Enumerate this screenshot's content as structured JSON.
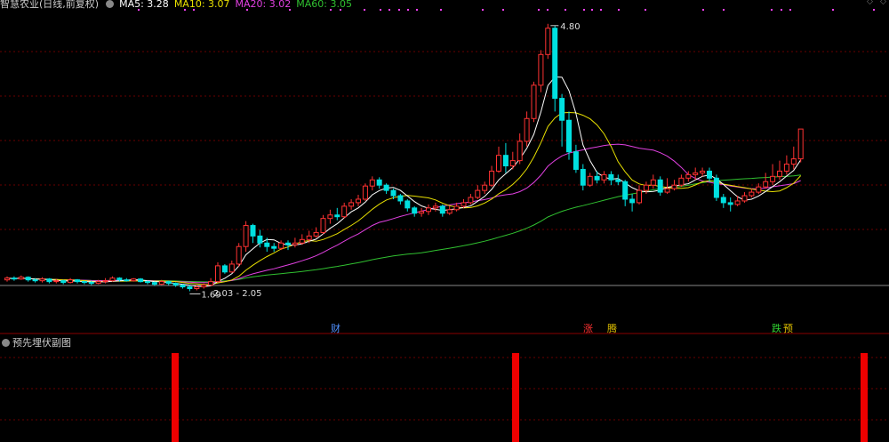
{
  "header": {
    "title": "智慧农业(日线,前复权)",
    "ma5_label": "MA5: 3.28",
    "ma10_label": "MA10: 3.07",
    "ma20_label": "MA20: 3.02",
    "ma60_label": "MA60: 3.05"
  },
  "subchart": {
    "title": "预先埋伏副图"
  },
  "colors": {
    "up": "#ff3232",
    "down": "#00e0e0",
    "ma5": "#ffffff",
    "ma10": "#e8e000",
    "ma20": "#e040e0",
    "ma60": "#30c030",
    "dot": "#ff40ff",
    "signal": "#ee0000",
    "grid": "#6a0000",
    "sep": "#8a0000",
    "title": "#cccccc"
  },
  "chart_data": {
    "type": "candlestick",
    "ylim": [
      1.4,
      4.95
    ],
    "annotations": {
      "high": "4.80",
      "low": "1.69",
      "range": "2.03 - 2.05"
    },
    "event_labels": [
      {
        "text": "财",
        "color": "#5090ff"
      },
      {
        "text": "涨",
        "color": "#ff3232"
      },
      {
        "text": "腾",
        "color": "#e0c000"
      },
      {
        "text": "跌",
        "color": "#30d030"
      },
      {
        "text": "预",
        "color": "#e0c000"
      }
    ],
    "candles": [
      [
        1.88,
        1.9,
        1.86,
        1.92
      ],
      [
        1.9,
        1.89,
        1.87,
        1.92
      ],
      [
        1.89,
        1.91,
        1.88,
        1.93
      ],
      [
        1.91,
        1.88,
        1.86,
        1.92
      ],
      [
        1.88,
        1.87,
        1.85,
        1.9
      ],
      [
        1.87,
        1.89,
        1.85,
        1.91
      ],
      [
        1.89,
        1.86,
        1.84,
        1.9
      ],
      [
        1.86,
        1.87,
        1.84,
        1.89
      ],
      [
        1.87,
        1.85,
        1.83,
        1.88
      ],
      [
        1.85,
        1.88,
        1.84,
        1.9
      ],
      [
        1.88,
        1.86,
        1.84,
        1.89
      ],
      [
        1.86,
        1.85,
        1.83,
        1.87
      ],
      [
        1.85,
        1.84,
        1.82,
        1.87
      ],
      [
        1.84,
        1.86,
        1.83,
        1.88
      ],
      [
        1.86,
        1.87,
        1.84,
        1.9
      ],
      [
        1.87,
        1.9,
        1.86,
        1.92
      ],
      [
        1.9,
        1.88,
        1.86,
        1.91
      ],
      [
        1.88,
        1.87,
        1.86,
        1.9
      ],
      [
        1.87,
        1.89,
        1.86,
        1.9
      ],
      [
        1.89,
        1.86,
        1.85,
        1.9
      ],
      [
        1.86,
        1.85,
        1.83,
        1.87
      ],
      [
        1.85,
        1.83,
        1.81,
        1.86
      ],
      [
        1.83,
        1.86,
        1.82,
        1.88
      ],
      [
        1.86,
        1.84,
        1.82,
        1.87
      ],
      [
        1.84,
        1.82,
        1.8,
        1.85
      ],
      [
        1.82,
        1.8,
        1.78,
        1.83
      ],
      [
        1.8,
        1.78,
        1.75,
        1.82
      ],
      [
        1.78,
        1.8,
        1.76,
        1.82
      ],
      [
        1.8,
        1.82,
        1.78,
        1.84
      ],
      [
        1.82,
        1.86,
        1.81,
        1.9
      ],
      [
        1.86,
        2.04,
        1.85,
        2.08
      ],
      [
        2.04,
        1.97,
        1.95,
        2.06
      ],
      [
        1.97,
        2.06,
        1.96,
        2.1
      ],
      [
        2.06,
        2.26,
        2.03,
        2.3
      ],
      [
        2.26,
        2.5,
        2.2,
        2.55
      ],
      [
        2.5,
        2.38,
        2.3,
        2.52
      ],
      [
        2.38,
        2.3,
        2.25,
        2.45
      ],
      [
        2.3,
        2.26,
        2.2,
        2.36
      ],
      [
        2.26,
        2.24,
        2.2,
        2.3
      ],
      [
        2.24,
        2.3,
        2.22,
        2.33
      ],
      [
        2.3,
        2.28,
        2.22,
        2.33
      ],
      [
        2.28,
        2.3,
        2.25,
        2.36
      ],
      [
        2.3,
        2.34,
        2.28,
        2.4
      ],
      [
        2.34,
        2.38,
        2.3,
        2.44
      ],
      [
        2.38,
        2.42,
        2.36,
        2.48
      ],
      [
        2.42,
        2.58,
        2.4,
        2.62
      ],
      [
        2.58,
        2.62,
        2.52,
        2.68
      ],
      [
        2.62,
        2.6,
        2.56,
        2.7
      ],
      [
        2.6,
        2.72,
        2.58,
        2.76
      ],
      [
        2.72,
        2.76,
        2.68,
        2.8
      ],
      [
        2.76,
        2.8,
        2.72,
        2.85
      ],
      [
        2.8,
        2.95,
        2.78,
        2.98
      ],
      [
        2.95,
        3.02,
        2.9,
        3.06
      ],
      [
        3.02,
        2.96,
        2.92,
        3.05
      ],
      [
        2.96,
        2.9,
        2.86,
        2.98
      ],
      [
        2.9,
        2.84,
        2.8,
        2.92
      ],
      [
        2.84,
        2.78,
        2.74,
        2.86
      ],
      [
        2.78,
        2.7,
        2.66,
        2.8
      ],
      [
        2.7,
        2.64,
        2.6,
        2.72
      ],
      [
        2.64,
        2.66,
        2.6,
        2.7
      ],
      [
        2.66,
        2.7,
        2.62,
        2.74
      ],
      [
        2.7,
        2.72,
        2.66,
        2.76
      ],
      [
        2.72,
        2.64,
        2.6,
        2.74
      ],
      [
        2.64,
        2.68,
        2.62,
        2.72
      ],
      [
        2.68,
        2.72,
        2.66,
        2.76
      ],
      [
        2.72,
        2.76,
        2.7,
        2.8
      ],
      [
        2.76,
        2.82,
        2.74,
        2.86
      ],
      [
        2.82,
        2.9,
        2.8,
        2.96
      ],
      [
        2.9,
        2.96,
        2.86,
        3.0
      ],
      [
        2.96,
        3.12,
        2.94,
        3.18
      ],
      [
        3.12,
        3.3,
        3.1,
        3.4
      ],
      [
        3.3,
        3.18,
        3.1,
        3.44
      ],
      [
        3.18,
        3.24,
        3.14,
        3.34
      ],
      [
        3.24,
        3.46,
        3.2,
        3.55
      ],
      [
        3.46,
        3.72,
        3.4,
        3.8
      ],
      [
        3.72,
        4.1,
        3.68,
        4.14
      ],
      [
        4.1,
        4.45,
        4.02,
        4.5
      ],
      [
        4.45,
        4.75,
        4.4,
        4.8
      ],
      [
        4.75,
        3.95,
        3.8,
        4.78
      ],
      [
        3.95,
        3.7,
        3.4,
        4.0
      ],
      [
        3.7,
        3.34,
        3.25,
        3.8
      ],
      [
        3.34,
        3.14,
        3.1,
        3.42
      ],
      [
        3.14,
        2.96,
        2.9,
        3.2
      ],
      [
        2.96,
        3.06,
        2.94,
        3.1
      ],
      [
        3.06,
        3.02,
        2.98,
        3.12
      ],
      [
        3.02,
        3.08,
        2.98,
        3.12
      ],
      [
        3.08,
        3.02,
        2.96,
        3.12
      ],
      [
        3.02,
        3.0,
        2.96,
        3.08
      ],
      [
        3.0,
        2.8,
        2.72,
        3.02
      ],
      [
        2.8,
        2.76,
        2.66,
        2.86
      ],
      [
        2.76,
        2.9,
        2.74,
        2.96
      ],
      [
        2.9,
        2.96,
        2.86,
        3.0
      ],
      [
        2.96,
        3.02,
        2.92,
        3.08
      ],
      [
        3.02,
        2.88,
        2.84,
        3.06
      ],
      [
        2.88,
        2.92,
        2.86,
        3.04
      ],
      [
        2.92,
        2.96,
        2.9,
        3.02
      ],
      [
        2.96,
        3.04,
        2.94,
        3.08
      ],
      [
        3.04,
        3.08,
        3.0,
        3.12
      ],
      [
        3.08,
        3.1,
        3.02,
        3.16
      ],
      [
        3.1,
        3.12,
        3.06,
        3.16
      ],
      [
        3.12,
        3.04,
        3.0,
        3.16
      ],
      [
        3.04,
        2.82,
        2.78,
        3.08
      ],
      [
        2.82,
        2.76,
        2.7,
        2.86
      ],
      [
        2.76,
        2.74,
        2.66,
        2.82
      ],
      [
        2.74,
        2.78,
        2.72,
        2.84
      ],
      [
        2.78,
        2.84,
        2.76,
        2.88
      ],
      [
        2.84,
        2.88,
        2.82,
        2.92
      ],
      [
        2.88,
        2.94,
        2.86,
        2.98
      ],
      [
        2.94,
        3.0,
        2.92,
        3.1
      ],
      [
        3.0,
        3.06,
        2.96,
        3.2
      ],
      [
        3.06,
        3.12,
        3.02,
        3.24
      ],
      [
        3.12,
        3.2,
        3.08,
        3.3
      ],
      [
        3.2,
        3.26,
        3.14,
        3.4
      ],
      [
        3.26,
        3.6,
        3.22,
        3.6
      ]
    ]
  }
}
